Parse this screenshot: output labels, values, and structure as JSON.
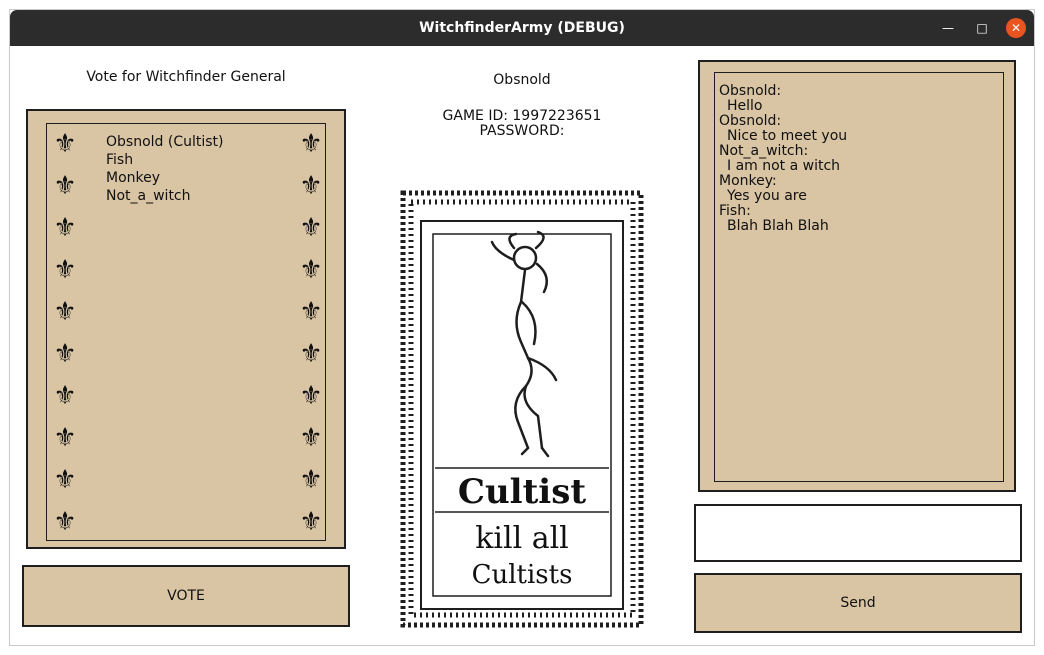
{
  "window": {
    "title": "WitchfinderArmy (DEBUG)"
  },
  "vote": {
    "heading": "Vote for Witchfinder General",
    "players": [
      "Obsnold (Cultist)",
      "Fish",
      "Monkey",
      "Not_a_witch"
    ],
    "button_label": "VOTE"
  },
  "game": {
    "player_name": "Obsnold",
    "game_id_line": "GAME ID: 1997223651",
    "password_line": "PASSWORD:"
  },
  "role_card": {
    "role": "Cultist",
    "goal_line1": "kill all",
    "goal_line2": "Cultists"
  },
  "chat": {
    "messages": [
      {
        "sender": "Obsnold:",
        "text": "Hello"
      },
      {
        "sender": "Obsnold:",
        "text": "Nice to meet you"
      },
      {
        "sender": "Not_a_witch:",
        "text": "I am not a witch"
      },
      {
        "sender": "Monkey:",
        "text": "Yes you are"
      },
      {
        "sender": "Fish:",
        "text": "Blah Blah Blah"
      }
    ],
    "input_value": "",
    "send_label": "Send"
  },
  "colors": {
    "parchment": "#d9c4a4",
    "ink": "#1e1e1e",
    "close_button": "#e95420",
    "titlebar": "#2c2c2c"
  }
}
